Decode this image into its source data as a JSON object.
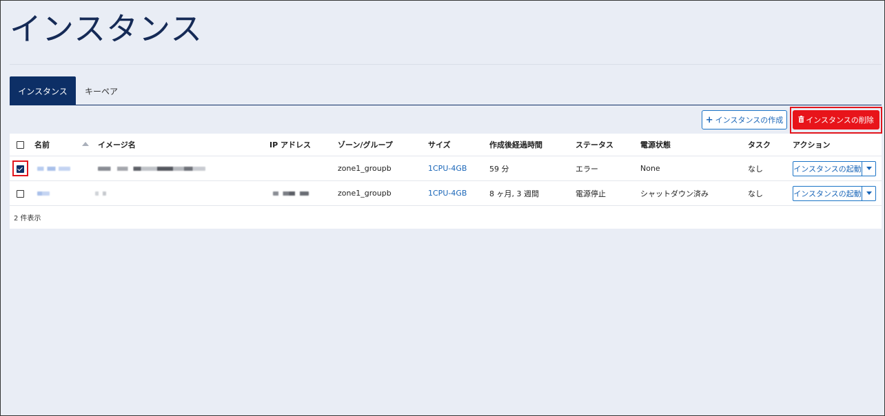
{
  "page": {
    "title": "インスタンス"
  },
  "tabs": [
    {
      "label": "インスタンス",
      "active": true
    },
    {
      "label": "キーペア",
      "active": false
    }
  ],
  "toolbar": {
    "create_icon": "plus-icon",
    "create_label": "インスタンスの作成",
    "delete_icon": "trash-icon",
    "delete_label": "インスタンスの削除"
  },
  "table": {
    "columns": [
      "名前",
      "イメージ名",
      "IP アドレス",
      "ゾーン/グループ",
      "サイズ",
      "作成後経過時間",
      "ステータス",
      "電源状態",
      "タスク",
      "アクション"
    ],
    "rows": [
      {
        "checked": true,
        "zone": "zone1_groupb",
        "size": "1CPU-4GB",
        "age": "59 分",
        "status": "エラー",
        "power": "None",
        "task": "なし",
        "action": "インスタンスの起動"
      },
      {
        "checked": false,
        "zone": "zone1_groupb",
        "size": "1CPU-4GB",
        "age": "8 ヶ月, 3 週間",
        "status": "電源停止",
        "power": "シャットダウン済み",
        "task": "なし",
        "action": "インスタンスの起動"
      }
    ],
    "footer": "2 件表示"
  },
  "colors": {
    "navy": "#0d2f66",
    "link_blue": "#1a66b8",
    "danger_red": "#e8141a",
    "background": "#e9edf5"
  }
}
